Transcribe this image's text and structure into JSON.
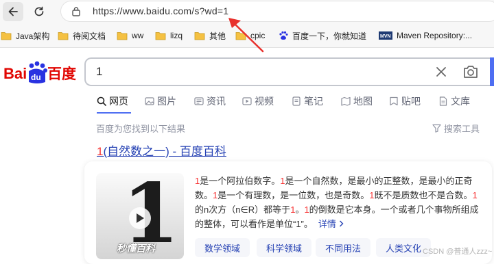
{
  "browser": {
    "url": "https://www.baidu.com/s?wd=1"
  },
  "bookmarks": [
    {
      "label": "Java架构",
      "icon": "folder-icon"
    },
    {
      "label": "待阅文档",
      "icon": "folder-icon"
    },
    {
      "label": "ww",
      "icon": "folder-icon"
    },
    {
      "label": "lizq",
      "icon": "folder-icon"
    },
    {
      "label": "其他",
      "icon": "folder-icon"
    },
    {
      "label": "cpic",
      "icon": "folder-icon"
    },
    {
      "label": "百度一下，你就知道",
      "icon": "baidu-paw-icon"
    },
    {
      "label": "Maven Repository:...",
      "icon": "mvn-icon"
    }
  ],
  "logo": {
    "text_latin": "Bai",
    "text_du": "du",
    "text_cn": "百度"
  },
  "search": {
    "query": "1"
  },
  "tabs": [
    {
      "label": "网页",
      "icon": "search-icon"
    },
    {
      "label": "图片",
      "icon": "image-icon"
    },
    {
      "label": "资讯",
      "icon": "news-icon"
    },
    {
      "label": "视频",
      "icon": "video-icon"
    },
    {
      "label": "笔记",
      "icon": "note-icon"
    },
    {
      "label": "地图",
      "icon": "map-icon"
    },
    {
      "label": "贴吧",
      "icon": "tieba-icon"
    },
    {
      "label": "文库",
      "icon": "doc-icon"
    }
  ],
  "results_info": "百度为您找到以下结果",
  "search_tools": "搜索工具",
  "result": {
    "title_hl": "1",
    "title_rest": "(自然数之一) - 百度百科",
    "thumb_brand": "秒懂百科",
    "desc_parts": [
      {
        "t": "1",
        "hl": true
      },
      {
        "t": "是一个阿拉伯数字。",
        "hl": false
      },
      {
        "t": "1",
        "hl": true
      },
      {
        "t": "是一个自然数，是最小的正整数，是最小的正奇数。",
        "hl": false
      },
      {
        "t": "1",
        "hl": true
      },
      {
        "t": "是一个有理数，是一位数，也是奇数。",
        "hl": false
      },
      {
        "t": "1",
        "hl": true
      },
      {
        "t": "既不是质数也不是合数。",
        "hl": false
      },
      {
        "t": "1",
        "hl": true
      },
      {
        "t": "的n次方（n∈R）都等于",
        "hl": false
      },
      {
        "t": "1",
        "hl": true
      },
      {
        "t": "。",
        "hl": false
      },
      {
        "t": "1",
        "hl": true
      },
      {
        "t": "的倒数是它本身。一个或者几个事物所组成的整体，可以看作是单位“1”。",
        "hl": false
      }
    ],
    "more": "详情",
    "chips": [
      "数学领域",
      "科学领域",
      "不同用法",
      "人类文化"
    ]
  },
  "watermark": "CSDN @普通人zzz~",
  "colors": {
    "accent": "#4e6ef2",
    "link": "#2440b3",
    "highlight": "#f73131"
  }
}
